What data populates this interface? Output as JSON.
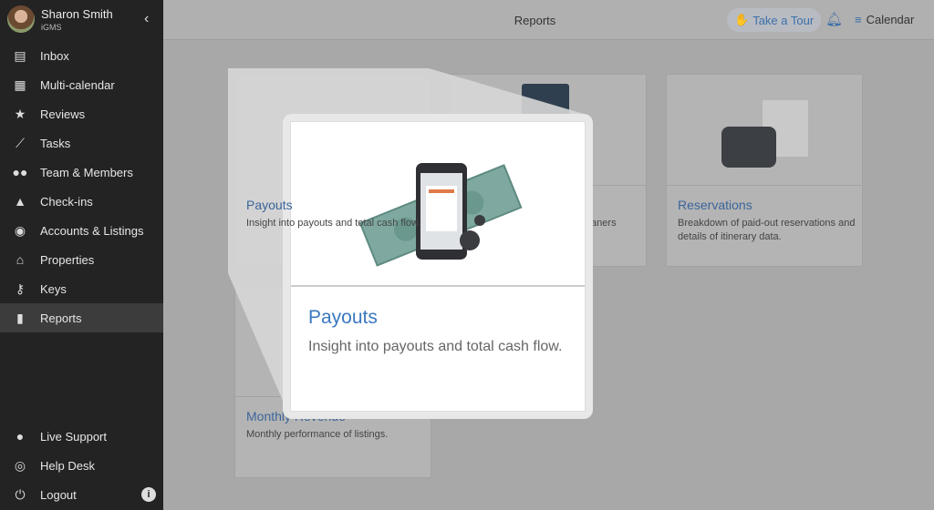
{
  "user": {
    "name": "Sharon Smith",
    "org": "iGMS"
  },
  "sidebar": {
    "items": [
      {
        "label": "Inbox",
        "icon": "message-icon"
      },
      {
        "label": "Multi-calendar",
        "icon": "calendar-icon"
      },
      {
        "label": "Reviews",
        "icon": "star-icon"
      },
      {
        "label": "Tasks",
        "icon": "broom-icon"
      },
      {
        "label": "Team & Members",
        "icon": "team-icon"
      },
      {
        "label": "Check-ins",
        "icon": "bell-icon"
      },
      {
        "label": "Accounts & Listings",
        "icon": "account-icon"
      },
      {
        "label": "Properties",
        "icon": "home-icon"
      },
      {
        "label": "Keys",
        "icon": "key-icon"
      },
      {
        "label": "Reports",
        "icon": "chart-icon",
        "active": true
      }
    ],
    "bottom": [
      {
        "label": "Live Support",
        "icon": "chat-icon"
      },
      {
        "label": "Help Desk",
        "icon": "lifebuoy-icon"
      },
      {
        "label": "Logout",
        "icon": "power-icon"
      }
    ],
    "info": "i"
  },
  "header": {
    "title": "Reports",
    "tour": "Take a Tour",
    "calendar": "Calendar"
  },
  "cards": [
    {
      "title": "Payouts",
      "desc": "Insight into payouts and total cash flow."
    },
    {
      "title": "",
      "desc": "cleaners"
    },
    {
      "title": "Reservations",
      "desc": "Breakdown of paid-out reservations and details of itinerary data."
    },
    {
      "title": "Monthly Revenue",
      "desc": "Monthly performance of listings."
    }
  ],
  "popup": {
    "title": "Payouts",
    "desc": "Insight into payouts and total cash flow."
  }
}
